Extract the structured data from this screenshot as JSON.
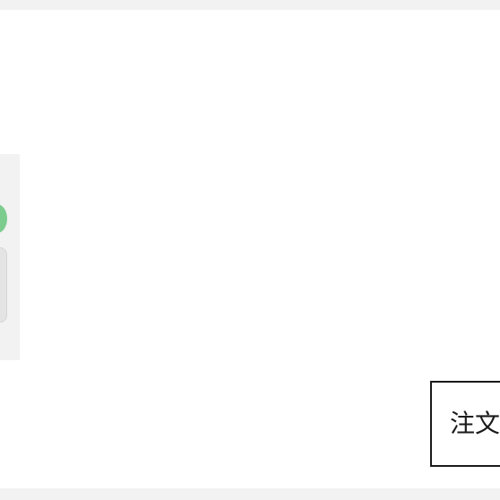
{
  "order_button": {
    "label": "注文"
  },
  "thumbnail": {
    "accent_color": "#7ccc8e",
    "background_color": "#f2f2f2"
  },
  "colors": {
    "band": "#f2f2f2",
    "button_border": "#1a1a1a",
    "page_background": "#ffffff"
  }
}
